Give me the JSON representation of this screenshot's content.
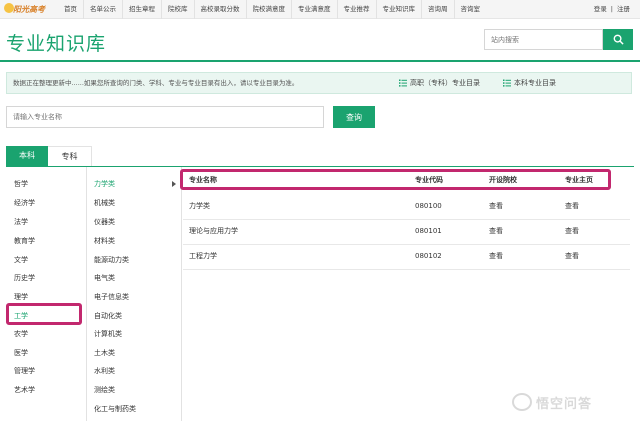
{
  "brand": {
    "logo_text": "阳光高考"
  },
  "nav": [
    "首页",
    "名单公示",
    "招生章程",
    "院校库",
    "高校录取分数",
    "院校满意度",
    "专业满意度",
    "专业推荐",
    "专业知识库",
    "咨询周",
    "咨询室"
  ],
  "auth": {
    "login": "登录",
    "sep": "|",
    "register": "注册"
  },
  "page_title": "专业知识库",
  "site_search": {
    "placeholder": "站内搜索"
  },
  "notice": {
    "text": "数据正在整理更新中......如果您所查询的门类、学科、专业与专业目录有出入，请以专业目录为准。",
    "link_vocational": "高职（专科）专业目录",
    "link_undergrad": "本科专业目录"
  },
  "major_search": {
    "placeholder": "请输入专业名称",
    "button": "查询"
  },
  "tabs": [
    "本科",
    "专科"
  ],
  "categories": [
    "哲学",
    "经济学",
    "法学",
    "教育学",
    "文学",
    "历史学",
    "理学",
    "工学",
    "农学",
    "医学",
    "管理学",
    "艺术学"
  ],
  "selected_category": "工学",
  "subcategories": [
    "力学类",
    "机械类",
    "仪器类",
    "材料类",
    "能源动力类",
    "电气类",
    "电子信息类",
    "自动化类",
    "计算机类",
    "土木类",
    "水利类",
    "测绘类",
    "化工与制药类"
  ],
  "selected_subcategory": "力学类",
  "table": {
    "headers": [
      "专业名称",
      "专业代码",
      "开设院校",
      "专业主页"
    ],
    "rows": [
      {
        "name": "力学类",
        "code": "080100",
        "schools": "查看",
        "home": "查看"
      },
      {
        "name": "理论与应用力学",
        "code": "080101",
        "schools": "查看",
        "home": "查看"
      },
      {
        "name": "工程力学",
        "code": "080102",
        "schools": "查看",
        "home": "查看"
      }
    ]
  },
  "watermark": {
    "text": "悟空问答"
  },
  "colors": {
    "accent": "#1aa36f",
    "highlight": "#c2286e",
    "notice_bg": "#eaf6f1"
  },
  "icons": [
    "search-icon",
    "list-icon",
    "chevron-right-icon"
  ]
}
